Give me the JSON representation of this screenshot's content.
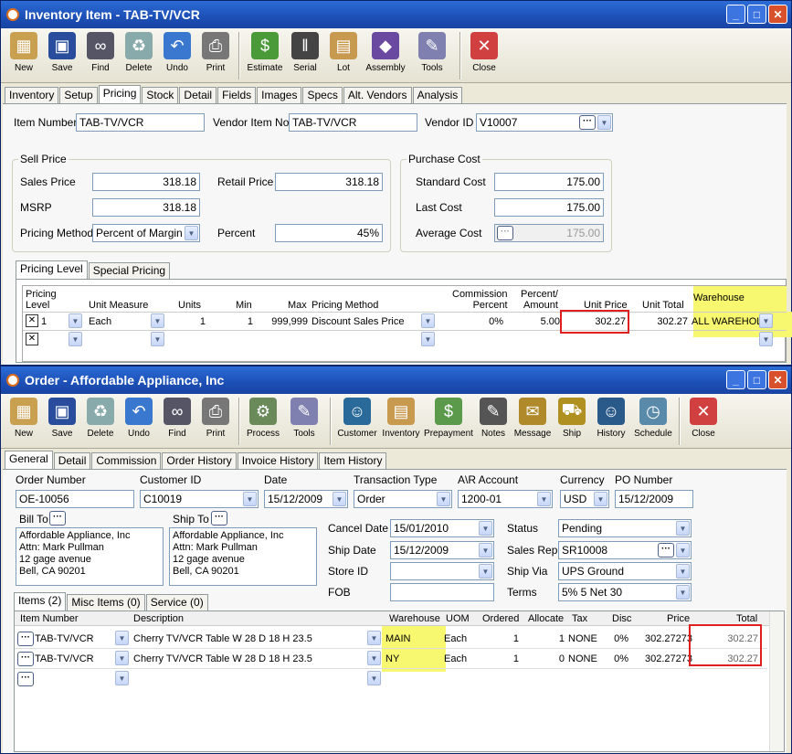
{
  "win1": {
    "title": "Inventory Item - TAB-TV/VCR",
    "toolbar": [
      "New",
      "Save",
      "Find",
      "Delete",
      "Undo",
      "Print",
      "Estimate",
      "Serial",
      "Lot",
      "Assembly",
      "Tools",
      "Close"
    ],
    "tabs": [
      "Inventory",
      "Setup",
      "Pricing",
      "Stock",
      "Detail",
      "Fields",
      "Images",
      "Specs",
      "Alt. Vendors",
      "Analysis"
    ],
    "item_number_label": "Item Number",
    "item_number": "TAB-TV/VCR",
    "vendor_item_label": "Vendor Item No",
    "vendor_item": "TAB-TV/VCR",
    "vendor_id_label": "Vendor ID",
    "vendor_id": "V10007",
    "sell_price_title": "Sell Price",
    "sales_price_label": "Sales Price",
    "sales_price": "318.18",
    "retail_price_label": "Retail Price",
    "retail_price": "318.18",
    "msrp_label": "MSRP",
    "msrp": "318.18",
    "pricing_method_label": "Pricing Method",
    "pricing_method": "Percent of Margin",
    "percent_label": "Percent",
    "percent": "45%",
    "purchase_cost_title": "Purchase Cost",
    "standard_cost_label": "Standard Cost",
    "standard_cost": "175.00",
    "last_cost_label": "Last Cost",
    "last_cost": "175.00",
    "average_cost_label": "Average Cost",
    "average_cost": "175.00",
    "subtabs": [
      "Pricing Level",
      "Special Pricing"
    ],
    "grid_headers": {
      "level": "Pricing\nLevel",
      "um": "Unit Measure",
      "units": "Units",
      "min": "Min",
      "max": "Max",
      "method": "Pricing Method",
      "comm": "Commission\nPercent",
      "pct": "Percent/\nAmount",
      "uprice": "Unit Price",
      "utotal": "Unit Total",
      "wh": "Warehouse"
    },
    "row": {
      "level": "1",
      "um": "Each",
      "units": "1",
      "min": "1",
      "max": "999,999",
      "method": "Discount Sales Price",
      "comm": "0%",
      "pct": "5.00",
      "uprice": "302.27",
      "utotal": "302.27",
      "wh": "ALL WAREHOL"
    }
  },
  "win2": {
    "title": "Order - Affordable Appliance, Inc",
    "toolbar": [
      "New",
      "Save",
      "Delete",
      "Undo",
      "Find",
      "Print",
      "Process",
      "Tools",
      "Customer",
      "Inventory",
      "Prepayment",
      "Notes",
      "Message",
      "Ship",
      "History",
      "Schedule",
      "Close"
    ],
    "tabs": [
      "General",
      "Detail",
      "Commission",
      "Order History",
      "Invoice History",
      "Item History"
    ],
    "order_number_label": "Order Number",
    "order_number": "OE-10056",
    "customer_id_label": "Customer ID",
    "customer_id": "C10019",
    "date_label": "Date",
    "date": "15/12/2009",
    "trans_type_label": "Transaction Type",
    "trans_type": "Order",
    "ar_label": "A\\R Account",
    "ar": "1200-01",
    "currency_label": "Currency",
    "currency": "USD",
    "po_label": "PO Number",
    "po": "15/12/2009",
    "bill_to_label": "Bill To",
    "bill_to": [
      "Affordable Appliance, Inc",
      "Attn: Mark Pullman",
      "12 gage avenue",
      "Bell, CA 90201"
    ],
    "ship_to_label": "Ship To",
    "ship_to": [
      "Affordable Appliance, Inc",
      "Attn: Mark Pullman",
      "12 gage avenue",
      "Bell, CA 90201"
    ],
    "cancel_label": "Cancel  Date",
    "cancel": "15/01/2010",
    "shipdate_label": "Ship Date",
    "shipdate": "15/12/2009",
    "store_label": "Store ID",
    "store": "",
    "fob_label": "FOB",
    "fob": "",
    "status_label": "Status",
    "status": "Pending",
    "salesrep_label": "Sales Rep",
    "salesrep": "SR10008",
    "shipvia_label": "Ship Via",
    "shipvia": "UPS Ground",
    "terms_label": "Terms",
    "terms": "5% 5 Net 30",
    "subtabs": [
      "Items (2)",
      "Misc Items (0)",
      "Service (0)"
    ],
    "grid_headers": {
      "item": "Item Number",
      "desc": "Description",
      "wh": "Warehouse",
      "uom": "UOM",
      "ord": "Ordered",
      "alloc": "Allocate",
      "tax": "Tax",
      "disc": "Disc",
      "price": "Price",
      "total": "Total"
    },
    "rows": [
      {
        "item": "TAB-TV/VCR",
        "desc": "Cherry TV/VCR Table  W 28 D 18 H 23.5",
        "wh": "MAIN",
        "uom": "Each",
        "ord": "1",
        "alloc": "1",
        "tax": "NONE",
        "disc": "0%",
        "price": "302.27273",
        "total": "302.27"
      },
      {
        "item": "TAB-TV/VCR",
        "desc": "Cherry TV/VCR Table  W 28 D 18 H 23.5",
        "wh": "NY",
        "uom": "Each",
        "ord": "1",
        "alloc": "0",
        "tax": "NONE",
        "disc": "0%",
        "price": "302.27273",
        "total": "302.27"
      }
    ]
  }
}
